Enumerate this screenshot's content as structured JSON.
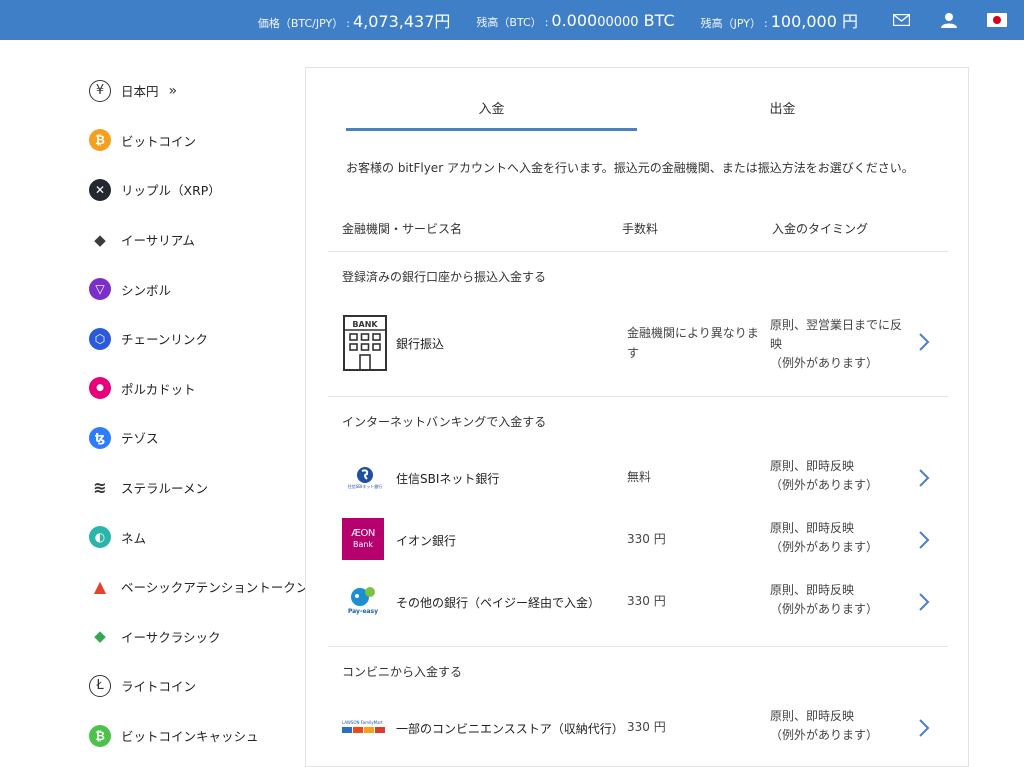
{
  "topbar": {
    "price_label": "価格（BTC/JPY）",
    "price_value": "4,073,437円",
    "btc_label": "残高（BTC）",
    "btc_value_main": "0.000",
    "btc_value_small": "00000",
    "btc_value_unit": " BTC",
    "jpy_label": "残高（JPY）",
    "jpy_value": "100,000 円",
    "separator": ":"
  },
  "sidebar": {
    "items": [
      {
        "label": "日本円",
        "glyph": "¥",
        "color": "#ffffff"
      },
      {
        "label": "ビットコイン",
        "glyph": "₿",
        "color": "#f2a01f"
      },
      {
        "label": "リップル（XRP）",
        "glyph": "✕",
        "color": "#23292f"
      },
      {
        "label": "イーサリアム",
        "glyph": "◆",
        "color": "#3c3c3d"
      },
      {
        "label": "シンボル",
        "glyph": "▽",
        "color": "#7b2fc9"
      },
      {
        "label": "チェーンリンク",
        "glyph": "⬡",
        "color": "#2a5ada"
      },
      {
        "label": "ポルカドット",
        "glyph": "●",
        "color": "#e6007a"
      },
      {
        "label": "テゾス",
        "glyph": "ꜩ",
        "color": "#2c7df7"
      },
      {
        "label": "ステラルーメン",
        "glyph": "≋",
        "color": "#333333"
      },
      {
        "label": "ネム",
        "glyph": "◐",
        "color": "#2bb4a8"
      },
      {
        "label": "ベーシックアテンショントークン",
        "glyph": "▲",
        "color": "#e2432a"
      },
      {
        "label": "イーサクラシック",
        "glyph": "◆",
        "color": "#33a853"
      },
      {
        "label": "ライトコイン",
        "glyph": "Ł",
        "color": "#ffffff"
      },
      {
        "label": "ビットコインキャッシュ",
        "glyph": "₿",
        "color": "#4cc24a"
      }
    ]
  },
  "tabs": {
    "deposit": "入金",
    "withdraw": "出金"
  },
  "intro": "お客様の bitFlyer アカウントへ入金を行います。振込元の金融機関、または振込方法をお選びください。",
  "table_header": {
    "name": "金融機関・サービス名",
    "fee": "手数料",
    "timing": "入金のタイミング"
  },
  "sections": {
    "registered": "登録済みの銀行口座から振込入金する",
    "internet": "インターネットバンキングで入金する",
    "convenience": "コンビニから入金する"
  },
  "rows": {
    "bank_transfer": {
      "name": "銀行振込",
      "logo_text": "BANK",
      "fee": "金融機関により異なります",
      "timing_1": "原則、翌営業日までに反映",
      "timing_2": "（例外があります）"
    },
    "sbi": {
      "name": "住信SBIネット銀行",
      "logo_text": "住信SBIネット銀行",
      "fee": "無料",
      "timing_1": "原則、即時反映",
      "timing_2": "（例外があります）"
    },
    "aeon": {
      "name": "イオン銀行",
      "logo_text": "ÆON",
      "logo_sub": "Bank",
      "fee": "330 円",
      "timing_1": "原則、即時反映",
      "timing_2": "（例外があります）"
    },
    "payeasy": {
      "name": "その他の銀行（ペイジー経由で入金）",
      "logo_text": "Pay-easy",
      "fee": "330 円",
      "timing_1": "原則、即時反映",
      "timing_2": "（例外があります）"
    },
    "konbini": {
      "name": "一部のコンビニエンスストア（収納代行）",
      "logo_text": "LAWSON FamilyMart",
      "fee": "330 円",
      "timing_1": "原則、即時反映",
      "timing_2": "（例外があります）"
    }
  },
  "colors": {
    "topbar": "#3e7fc8",
    "accent": "#4d7fc4",
    "arrow": "#4d7fc4"
  }
}
